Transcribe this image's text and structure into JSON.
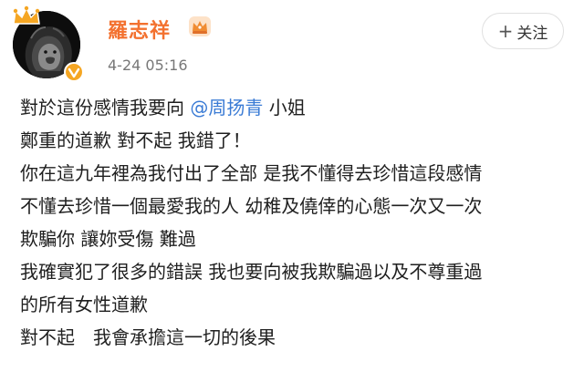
{
  "user": {
    "name": "羅志祥",
    "time": "4-24 05:16",
    "follow_label": "关注",
    "follow_icon": "plus-icon"
  },
  "post": {
    "line1_pre": "對於這份感情我要向 ",
    "mention": "@周扬青",
    "line1_post": " 小姐",
    "lines": [
      "鄭重的道歉 對不起 我錯了！",
      "你在這九年裡為我付出了全部 是我不懂得去珍惜這段感情",
      "不懂去珍惜一個最愛我的人 幼稚及僥倖的心態一次又一次",
      "欺騙你 讓妳受傷 難過",
      "我確實犯了很多的錯誤 我也要向被我欺騙過以及不尊重過",
      "的所有女性道歉",
      "對不起　我會承擔這一切的後果"
    ]
  },
  "colors": {
    "username": "#f3712f",
    "mention": "#3a7bd5",
    "verified_badge": "#f5a623",
    "crown": "#f5a623"
  },
  "icons": [
    "lion-avatar",
    "crown-icon",
    "verified-icon",
    "vip-crown-icon",
    "plus-icon"
  ]
}
